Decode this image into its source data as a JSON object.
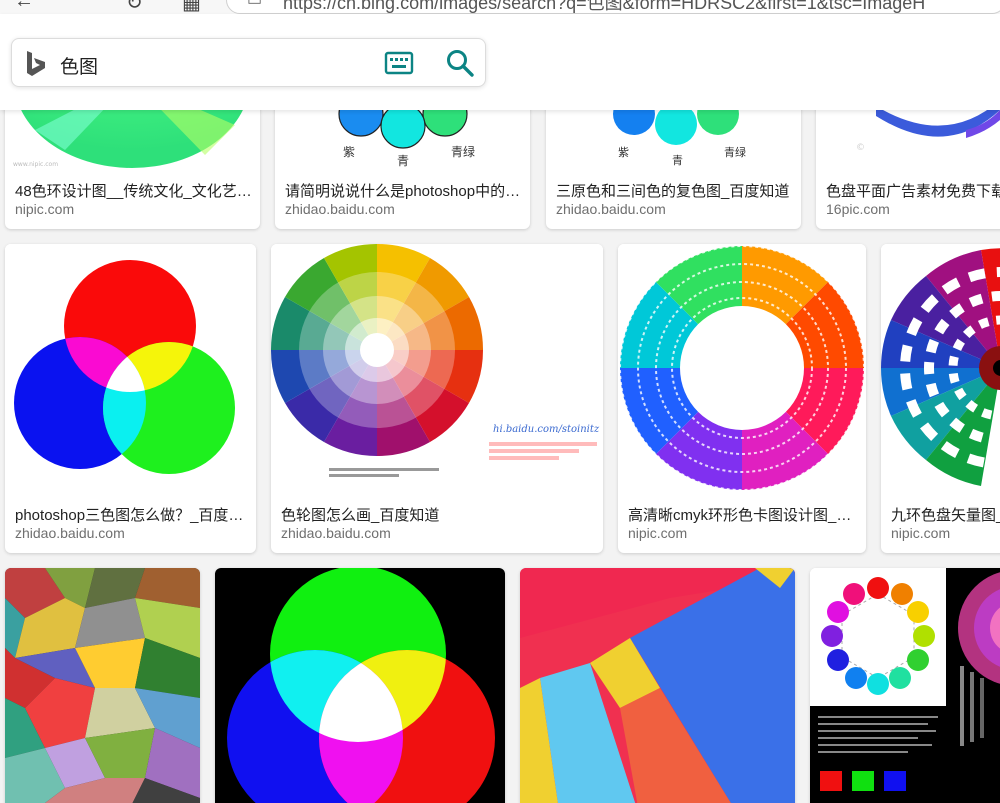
{
  "browser": {
    "url_text": "https://cn.bing.com/images/search?q=色图&form=HDRSC2&first=1&tsc=ImageH"
  },
  "search": {
    "query": "色图"
  },
  "results": [
    {
      "title": "48色环设计图__传统文化_文化艺…",
      "source": "nipic.com"
    },
    {
      "title": "请简明说说什么是photoshop中的…",
      "source": "zhidao.baidu.com"
    },
    {
      "title": "三原色和三间色的复色图_百度知道",
      "source": "zhidao.baidu.com"
    },
    {
      "title": "色盘平面广告素材免费下载",
      "source": "16pic.com"
    },
    {
      "title": "photoshop三色图怎么做？_百度…",
      "source": "zhidao.baidu.com"
    },
    {
      "title": "色轮图怎么画_百度知道",
      "source": "zhidao.baidu.com",
      "watermark": "hi.baidu.com/stoinitz"
    },
    {
      "title": "高清晰cmyk环形色卡图设计图__…",
      "source": "nipic.com"
    },
    {
      "title": "九环色盘矢量图_",
      "source": "nipic.com"
    },
    {
      "title": "",
      "source": ""
    },
    {
      "title": "",
      "source": ""
    },
    {
      "title": "",
      "source": ""
    },
    {
      "title": "",
      "source": ""
    }
  ],
  "colors": {
    "accent": "#0c8484",
    "bing_logo": "#555555",
    "source_text": "#6f6f6f"
  }
}
